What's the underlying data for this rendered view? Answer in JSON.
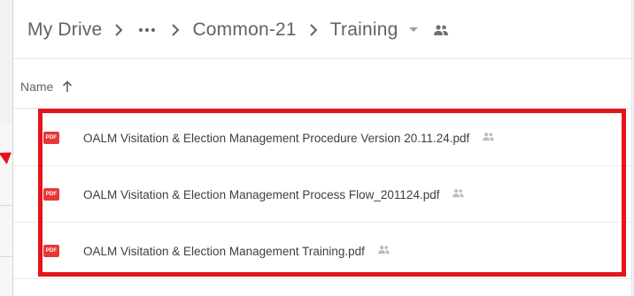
{
  "breadcrumb": {
    "items": [
      "My Drive",
      "Common-21",
      "Training"
    ],
    "more_icon": "more-horiz-icon",
    "separator_icon": "chevron-right-icon",
    "dropdown_icon": "arrow-drop-down-icon",
    "shared_icon": "shared-people-icon"
  },
  "list": {
    "sort_column": "Name",
    "sort_icon": "arrow-upward-icon",
    "files": [
      {
        "name": "OALM Visitation & Election Management Procedure Version 20.11.24.pdf",
        "icon": "pdf-icon",
        "badge": "PDF",
        "shared": true
      },
      {
        "name": "OALM Visitation & Election Management Process Flow_201124.pdf",
        "icon": "pdf-icon",
        "badge": "PDF",
        "shared": true
      },
      {
        "name": "OALM Visitation & Election Management Training.pdf",
        "icon": "pdf-icon",
        "badge": "PDF",
        "shared": true
      }
    ]
  },
  "colors": {
    "highlight": "#e5141b",
    "pdf_icon": "#e53935",
    "text": "#3c4043",
    "muted": "#5f6368"
  }
}
